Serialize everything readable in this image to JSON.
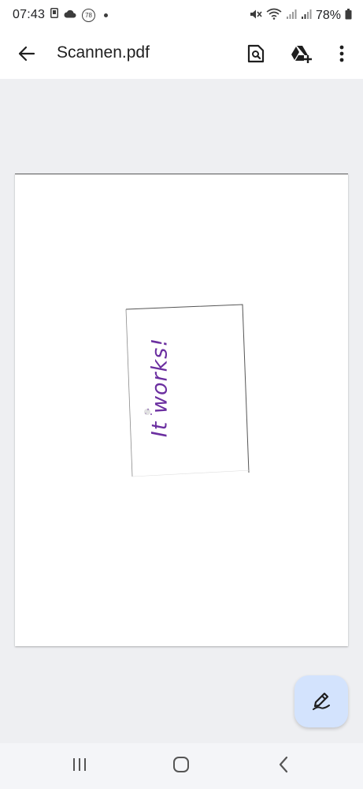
{
  "status_bar": {
    "time": "07:43",
    "notification_badge": "78",
    "battery_percent": "78%",
    "icons": [
      "sim-card-icon",
      "cloud-icon",
      "notification-badge-icon",
      "dot-icon",
      "mute-icon",
      "wifi-icon",
      "signal-icon",
      "signal-icon",
      "battery-icon"
    ]
  },
  "app_bar": {
    "title": "Scannen.pdf",
    "back_icon": "arrow-back-icon",
    "actions": [
      "search-document-icon",
      "add-to-drive-icon",
      "more-vert-icon"
    ]
  },
  "document": {
    "handwritten_text": "It works!",
    "ink_color": "#6b2fa0"
  },
  "fab": {
    "icon": "edit-pen-icon",
    "color": "#d3e3fd"
  },
  "nav_bar": {
    "icons": [
      "recents-icon",
      "home-icon",
      "back-icon"
    ]
  }
}
